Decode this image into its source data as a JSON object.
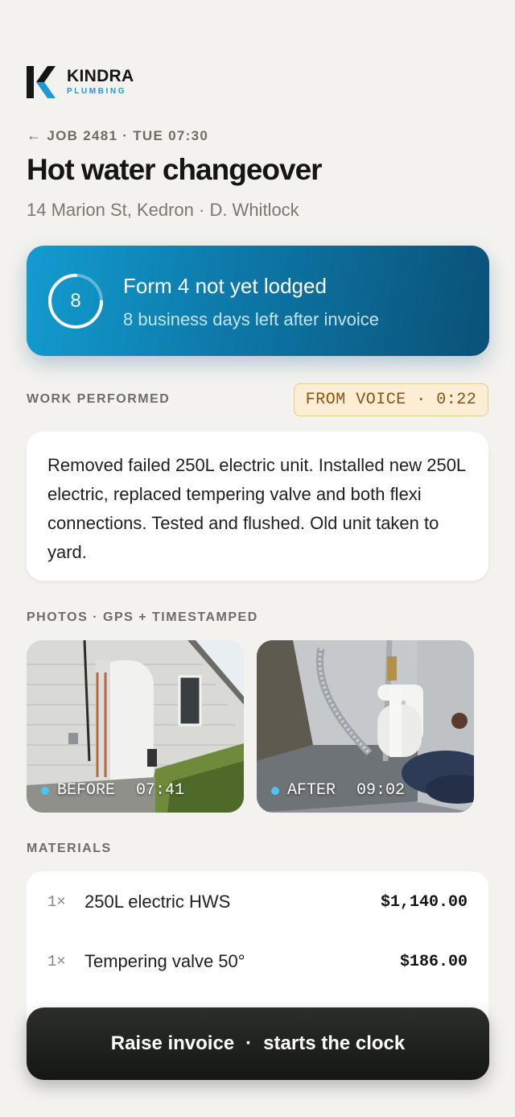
{
  "brand": {
    "name": "KINDRA",
    "sub": "PLUMBING",
    "accent": "#1d9ad6"
  },
  "job": {
    "crumb": "JOB 2481 · TUE 07:30",
    "title": "Hot water changeover",
    "address": "14 Marion St, Kedron · D. Whitlock"
  },
  "alert": {
    "days": "8",
    "title": "Form 4 not yet lodged",
    "subtitle": "8 business days left after invoice",
    "color": "#0d78a8"
  },
  "work": {
    "label": "WORK PERFORMED",
    "tag": "FROM VOICE · 0:22",
    "text": "Removed failed 250L electric unit. Installed new 250L electric, replaced tempering valve and both flexi connections. Tested and flushed. Old unit taken to yard."
  },
  "photos": {
    "label": "PHOTOS · GPS + TIMESTAMPED",
    "items": [
      {
        "tag": "BEFORE",
        "time": "07:41"
      },
      {
        "tag": "AFTER",
        "time": "09:02"
      }
    ]
  },
  "materials": {
    "label": "MATERIALS",
    "items": [
      {
        "qty": "1×",
        "name": "250L electric HWS",
        "price": "$1,140.00"
      },
      {
        "qty": "1×",
        "name": "Tempering valve 50°",
        "price": "$186.00"
      }
    ]
  },
  "cta": {
    "left": "Raise invoice",
    "sep": "·",
    "right": "starts the clock"
  }
}
